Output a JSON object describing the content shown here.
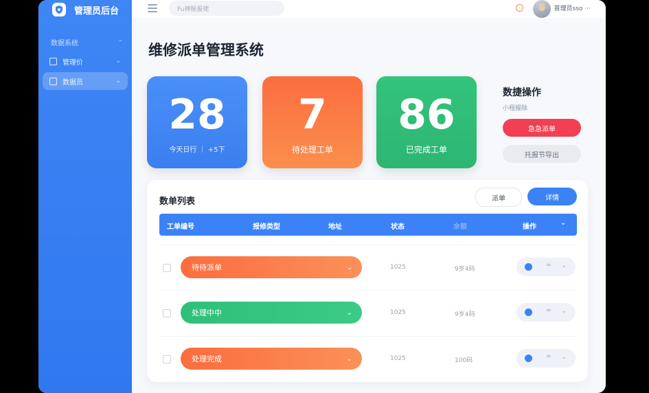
{
  "brand": {
    "title": "管理员后台"
  },
  "sidebar": {
    "group_label": "数据系统",
    "group_toggle": "–",
    "items": [
      {
        "label": "管理价",
        "active": false
      },
      {
        "label": "数据员",
        "active": true
      }
    ]
  },
  "topbar": {
    "search_placeholder": "Fu神账报佬",
    "user_name": "普理员sso ···"
  },
  "page": {
    "title": "维修派单管理系统"
  },
  "stats": [
    {
      "value": "28",
      "caption": "今天日行 ｜ +5下",
      "color": "#3f86f5"
    },
    {
      "value": "7",
      "caption": "待处理工单",
      "color": "#fb7a45"
    },
    {
      "value": "86",
      "caption": "已完成工单",
      "color": "#31bf78"
    }
  ],
  "quick_actions": {
    "title": "数捷操作",
    "subtitle": "小程报除",
    "primary_label": "急急派单",
    "secondary_label": "托报节导出"
  },
  "order_list": {
    "title": "数单列表",
    "btn_dispatch": "派单",
    "btn_detail": "详情",
    "columns": [
      "工单编号",
      "报修类型",
      "地址",
      "状态",
      "余额",
      "操作"
    ],
    "rows": [
      {
        "status": "待待派单",
        "status_color": "orange",
        "col_a": "1025",
        "col_b": "9岁4码"
      },
      {
        "status": "处理中中",
        "status_color": "green",
        "col_a": "1025",
        "col_b": "9岁4码"
      },
      {
        "status": "处理完成",
        "status_color": "orange",
        "col_a": "1025",
        "col_b": "100码"
      }
    ],
    "row_action_eq": "=",
    "row_action_chevron": "⌄"
  }
}
